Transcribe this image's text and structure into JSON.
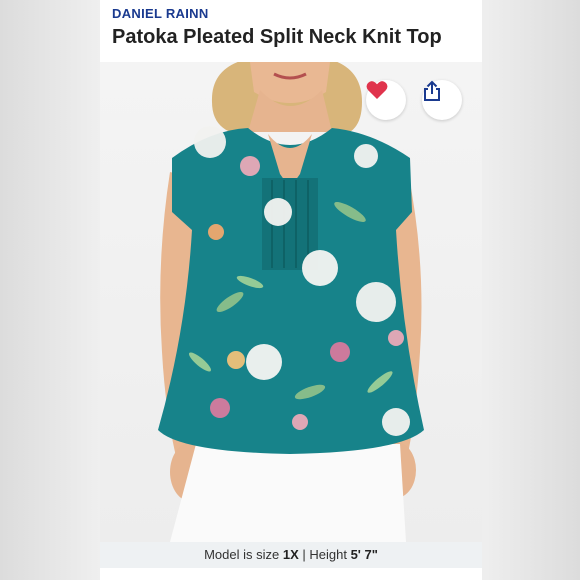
{
  "listing": {
    "brand": "DANIEL RAINN",
    "title": "Patoka Pleated Split Neck Knit Top"
  },
  "actions": {
    "like_icon": "heart-icon",
    "share_icon": "share-icon"
  },
  "fit_note": {
    "size_prefix": "Model is size ",
    "size_value": "1X",
    "separator": " | ",
    "height_prefix": "Height ",
    "height_value": "5' 7\""
  },
  "colors": {
    "brand": "#1a3a8f",
    "heart": "#e0334c",
    "top": "#17838a"
  }
}
